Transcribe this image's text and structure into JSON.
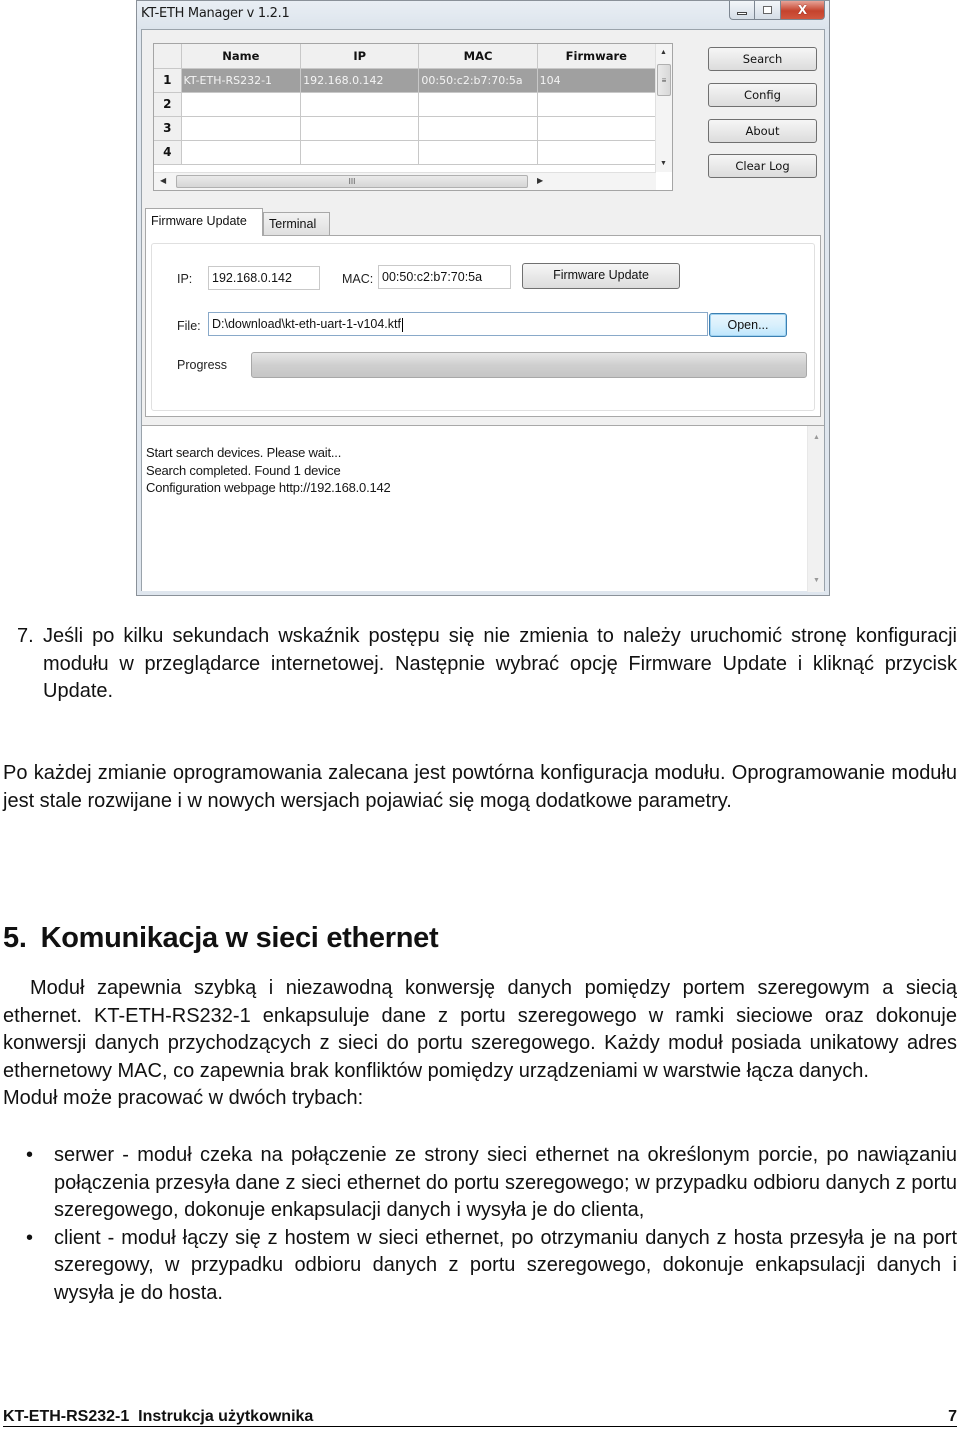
{
  "window": {
    "title": "KT-ETH Manager v 1.2.1",
    "controls": {
      "minimize": "minimize",
      "maximize": "maximize",
      "close": "X"
    }
  },
  "device_grid": {
    "columns": [
      "Name",
      "IP",
      "MAC",
      "Firmware"
    ],
    "rows": [
      {
        "row_header": "1",
        "name": "KT-ETH-RS232-1",
        "ip": "192.168.0.142",
        "mac": "00:50:c2:b7:70:5a",
        "firmware": "104",
        "selected": true
      },
      {
        "row_header": "2",
        "name": "",
        "ip": "",
        "mac": "",
        "firmware": "",
        "selected": false
      },
      {
        "row_header": "3",
        "name": "",
        "ip": "",
        "mac": "",
        "firmware": "",
        "selected": false
      },
      {
        "row_header": "4",
        "name": "",
        "ip": "",
        "mac": "",
        "firmware": "",
        "selected": false
      }
    ],
    "scroll_thumb_glyph": "≡",
    "hscroll_thumb_glyph": "III"
  },
  "side_buttons": {
    "search": "Search",
    "config": "Config",
    "about": "About",
    "clear_log": "Clear Log"
  },
  "tabs": [
    {
      "label": "Firmware Update",
      "active": true
    },
    {
      "label": "Terminal",
      "active": false
    }
  ],
  "firmware_update": {
    "ip_label": "IP:",
    "ip_value": "192.168.0.142",
    "mac_label": "MAC:",
    "mac_value": "00:50:c2:b7:70:5a",
    "update_button": "Firmware Update",
    "file_label": "File:",
    "file_value": "D:\\download\\kt-eth-uart-1-v104.ktf",
    "open_button": "Open...",
    "progress_label": "Progress",
    "progress_percent": 0
  },
  "log": {
    "lines": [
      "Start search devices. Please wait...",
      "Search completed. Found 1 device",
      "Configuration webpage http://192.168.0.142"
    ]
  },
  "document": {
    "step7": {
      "number": "7.",
      "text": "Jeśli po kilku sekundach wskaźnik postępu się nie zmienia to należy uruchomić stronę konfiguracji modułu w przeglądarce internetowej. Następnie wybrać opcję Firmware Update i kliknąć przycisk Update."
    },
    "note": "Po każdej zmianie oprogramowania zalecana jest powtórna konfiguracja modułu. Oprogramowanie modułu jest stale rozwijane i w nowych wersjach pojawiać się mogą dodatkowe parametry.",
    "section": {
      "number": "5.",
      "title": "Komunikacja w sieci ethernet"
    },
    "intro": "Moduł zapewnia szybką i niezawodną konwersję danych pomiędzy portem szeregowym a siecią ethernet. KT-ETH-RS232-1 enkapsuluje dane z portu szeregowego w ramki sieciowe oraz dokonuje konwersji danych przychodzących z sieci do portu szeregowego. Każdy moduł posiada unikatowy adres ethernetowy MAC, co zapewnia brak konfliktów pomiędzy urządzeniami w warstwie łącza danych.",
    "modes_intro": "Moduł może pracować w dwóch trybach:",
    "modes": [
      "serwer - moduł czeka na połączenie ze strony sieci ethernet na określonym porcie, po nawiązaniu połączenia przesyła dane z sieci ethernet do portu szeregowego; w przypadku odbioru danych z portu szeregowego, dokonuje enkapsulacji danych i wysyła je do clienta,",
      "client - moduł łączy się z hostem w sieci ethernet, po otrzymaniu danych z hosta przesyła je na port szeregowy, w przypadku odbioru danych z portu szeregowego, dokonuje enkapsulacji danych i wysyła je do hosta."
    ],
    "bullet_glyph": "•"
  },
  "footer": {
    "title": "KT-ETH-RS232-1  Instrukcja użytkownika",
    "page_number": "7"
  }
}
